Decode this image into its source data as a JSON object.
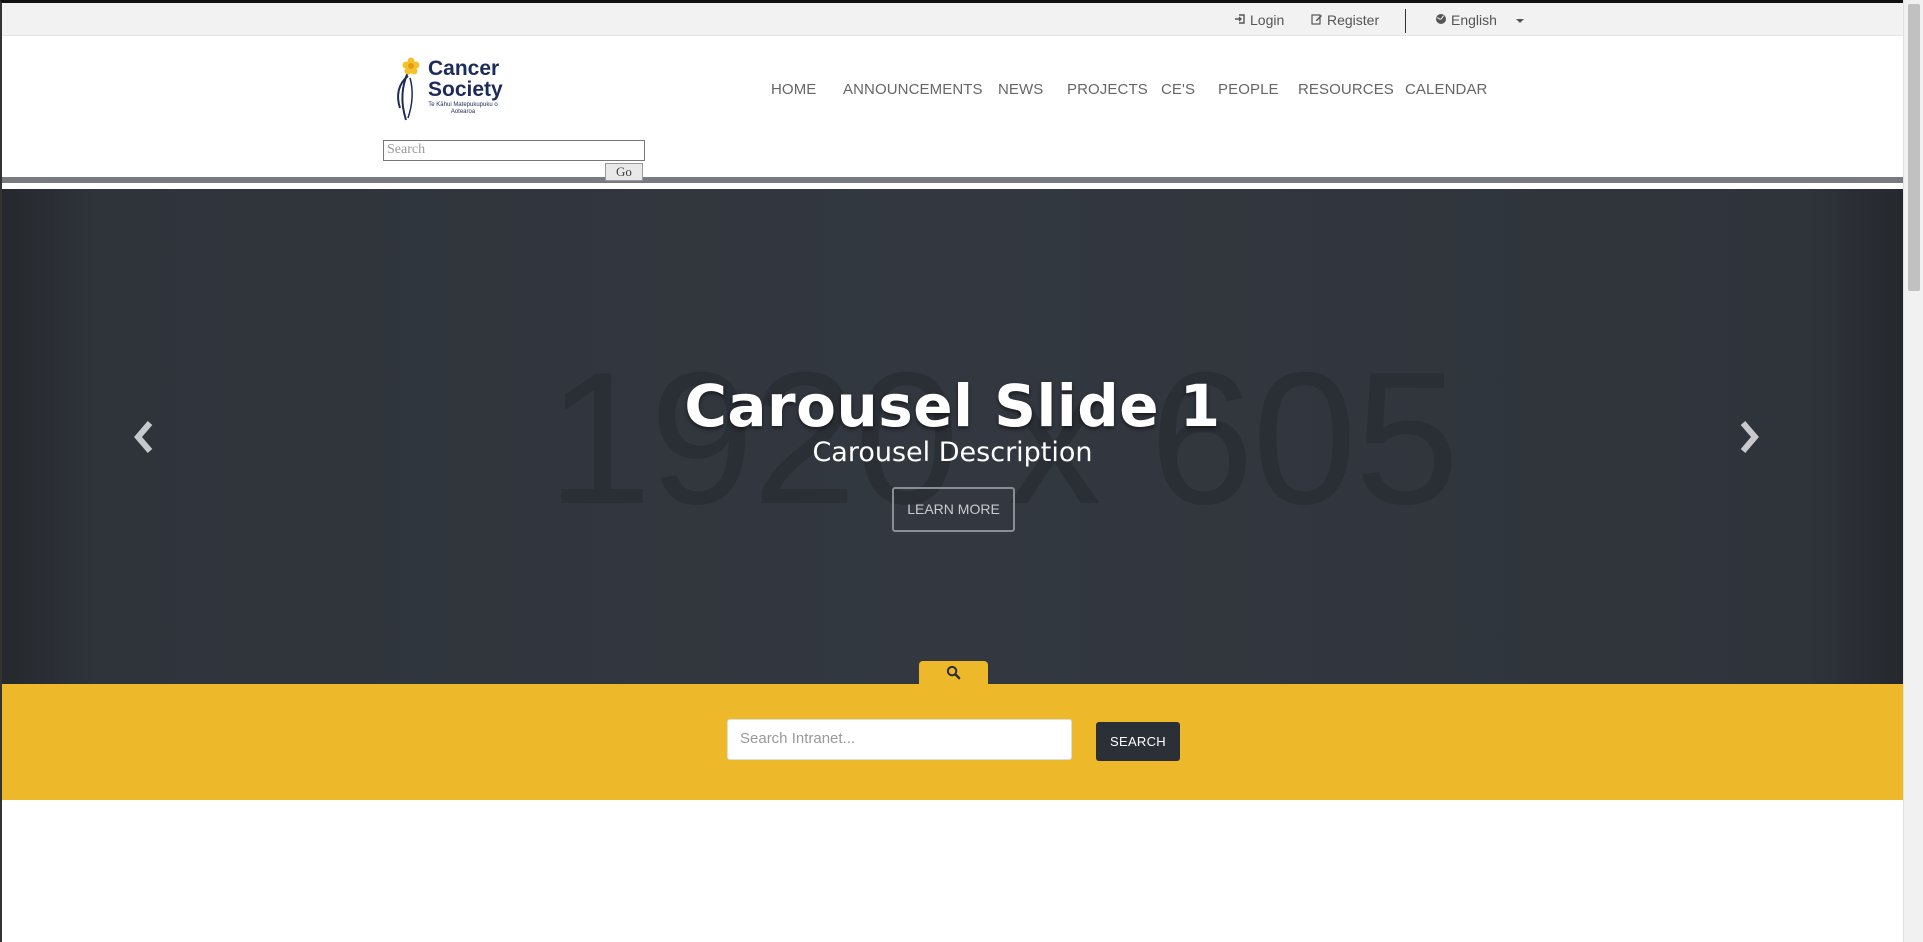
{
  "topbar": {
    "login": "Login",
    "register": "Register",
    "language": "English"
  },
  "logo": {
    "line1": "Cancer",
    "line2": "Society",
    "subtitle": "Te Kāhui Matepukupuku o Aotearoa"
  },
  "nav": {
    "items": [
      "HOME",
      "ANNOUNCEMENTS",
      "NEWS",
      "PROJECTS",
      "CE'S",
      "PEOPLE",
      "RESOURCES",
      "CALENDAR"
    ]
  },
  "header_search": {
    "placeholder": "Search",
    "button": "Go"
  },
  "carousel": {
    "placeholder_text": "1920 x 605",
    "title": "Carousel Slide 1",
    "description": "Carousel Description",
    "cta": "LEARN MORE"
  },
  "intranet_search": {
    "placeholder": "Search Intranet...",
    "button": "SEARCH"
  },
  "colors": {
    "accent": "#eeb82b",
    "dark": "#2b2f36",
    "brand_navy": "#1d2b5a"
  }
}
